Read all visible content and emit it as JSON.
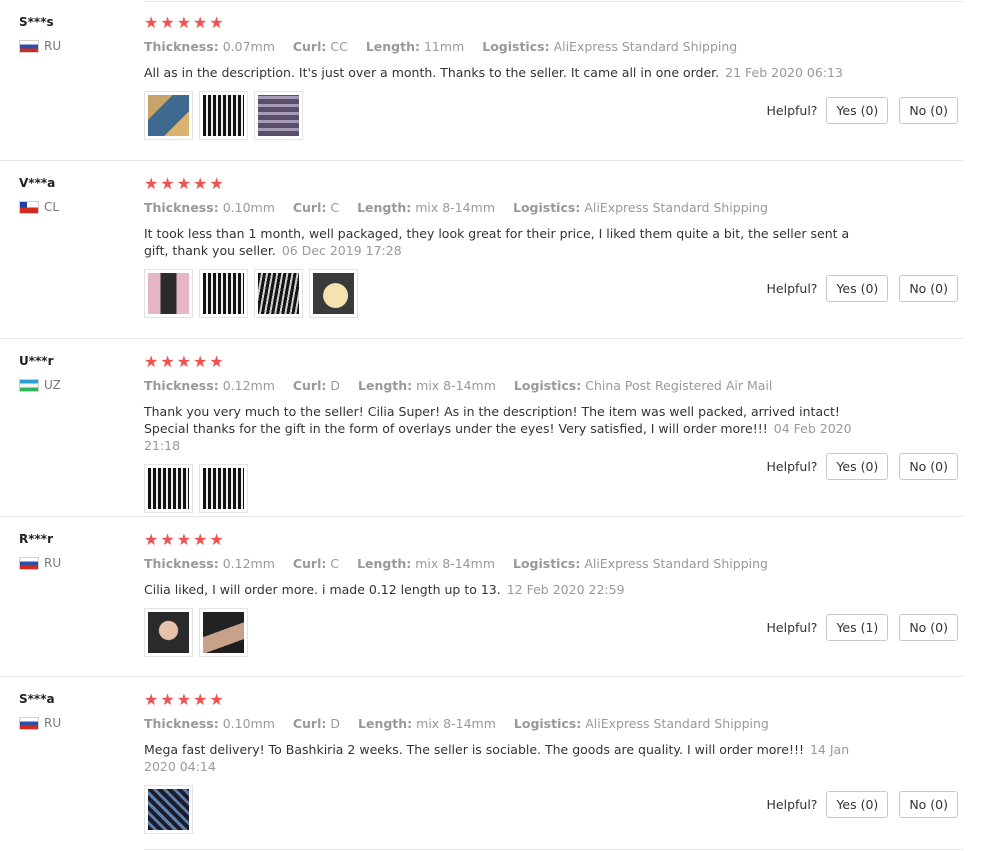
{
  "labels": {
    "thickness": "Thickness:",
    "curl": "Curl:",
    "length": "Length:",
    "logistics": "Logistics:",
    "helpful": "Helpful?"
  },
  "star_icon": "★",
  "reviews": [
    {
      "user": "S***s",
      "country": "RU",
      "flag": "russia-flag-icon",
      "rating": 5,
      "thickness": "0.07mm",
      "curl": "CC",
      "length": "11mm",
      "logistics": "AliExpress Standard Shipping",
      "text": "All as in the description. It's just over a month. Thanks to the seller. It came all in one order.",
      "date": "21 Feb 2020 06:13",
      "yes": "Yes (0)",
      "no": "No (0)",
      "photos": [
        "lash-box-photo",
        "lash-tray-photo",
        "lash-boxes-stack-photo"
      ]
    },
    {
      "user": "V***a",
      "country": "CL",
      "flag": "chile-flag-icon",
      "rating": 5,
      "thickness": "0.10mm",
      "curl": "C",
      "length": "mix 8-14mm",
      "logistics": "AliExpress Standard Shipping",
      "text": "It took less than 1 month, well packaged, they look great for their price, I liked them quite a bit, the seller sent a gift, thank you seller.",
      "date": "06 Dec 2019 17:28",
      "yes": "Yes (0)",
      "no": "No (0)",
      "photos": [
        "pink-lash-box-photo",
        "lash-tray-photo",
        "lash-tray-angled-photo",
        "eye-patch-photo"
      ]
    },
    {
      "user": "U***r",
      "country": "UZ",
      "flag": "uzbekistan-flag-icon",
      "rating": 5,
      "thickness": "0.12mm",
      "curl": "D",
      "length": "mix 8-14mm",
      "logistics": "China Post Registered Air Mail",
      "text": "Thank you very much to the seller! Cilia Super! As in the description! The item was well packed, arrived intact! Special thanks for the gift in the form of overlays under the eyes! Very satisfied, I will order more!!!",
      "date": "04 Feb 2020 21:18",
      "yes": "Yes (0)",
      "no": "No (0)",
      "photos": [
        "lash-tray-photo",
        "lash-tray-photo"
      ]
    },
    {
      "user": "R***r",
      "country": "RU",
      "flag": "russia-flag-icon",
      "rating": 5,
      "thickness": "0.12mm",
      "curl": "C",
      "length": "mix 8-14mm",
      "logistics": "AliExpress Standard Shipping",
      "text": "Cilia liked, I will order more. i made 0.12 length up to 13.",
      "date": "12 Feb 2020 22:59",
      "yes": "Yes (1)",
      "no": "No (0)",
      "photos": [
        "face-selfie-photo",
        "closed-eye-photo"
      ]
    },
    {
      "user": "S***a",
      "country": "RU",
      "flag": "russia-flag-icon",
      "rating": 5,
      "thickness": "0.10mm",
      "curl": "D",
      "length": "mix 8-14mm",
      "logistics": "AliExpress Standard Shipping",
      "text": "Mega fast delivery! To Bashkiria 2 weeks. The seller is sociable. The goods are quality. I will order more!!!",
      "date": "14 Jan 2020 04:14",
      "yes": "Yes (0)",
      "no": "No (0)",
      "photos": [
        "lash-tray-blue-photo"
      ]
    }
  ]
}
